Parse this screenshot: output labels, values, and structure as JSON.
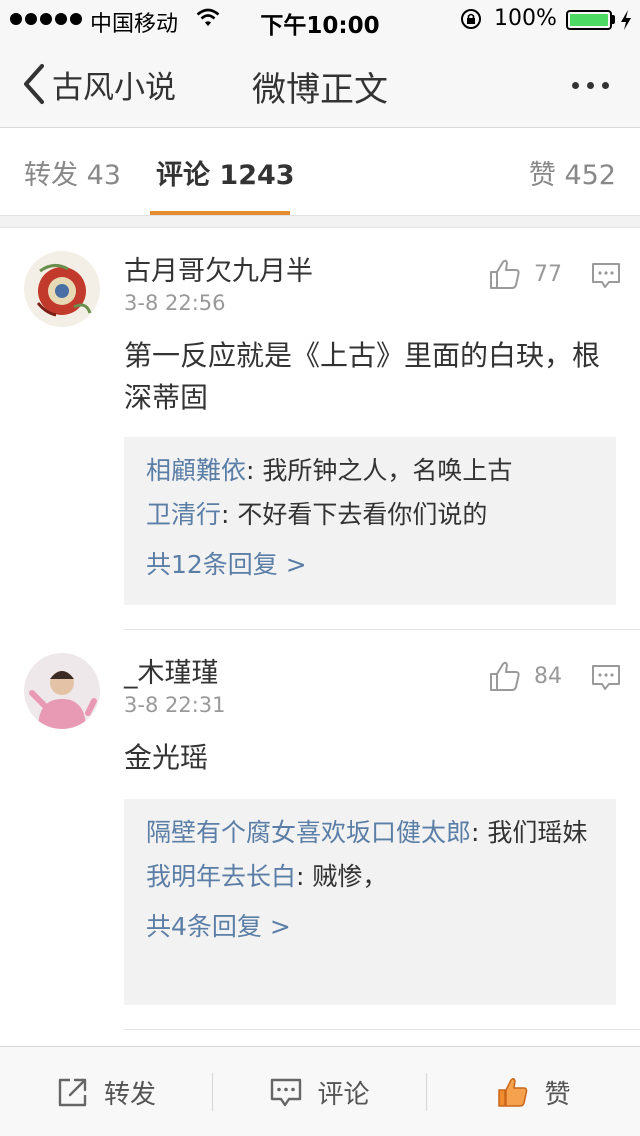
{
  "status_bar": {
    "carrier": "中国移动",
    "time": "下午10:00",
    "battery": "100%",
    "battery_color": "#4cd964"
  },
  "nav": {
    "back_label": "古风小说",
    "title": "微博正文",
    "back_icon": "chevron-left-icon",
    "more_icon": "more-dots-icon"
  },
  "tabs": {
    "repost": {
      "label": "转发",
      "count": "43"
    },
    "comment": {
      "label": "评论",
      "count": "1243"
    },
    "like": {
      "label": "赞",
      "count": "452"
    },
    "active_color": "#e68a2e"
  },
  "comments": [
    {
      "user": "古月哥欠九月半",
      "time": "3-8 22:56",
      "likes": "77",
      "text": "第一反应就是《上古》里面的白玦，根深蒂固",
      "replies": [
        {
          "user": "相顧難依",
          "text": ": 我所钟之人，名唤上古"
        },
        {
          "user": "卫清行",
          "text": ": 不好看下去看你们说的"
        }
      ],
      "more": "共12条回复 >"
    },
    {
      "user": "_木瑾瑾",
      "time": "3-8 22:31",
      "likes": "84",
      "text": "金光瑶",
      "replies": [
        {
          "user": "隔壁有个腐女喜欢坂口健太郎",
          "text": ": 我们瑶妹"
        },
        {
          "user": "我明年去长白",
          "text": ": 贼惨，"
        }
      ],
      "more": "共4条回复 >"
    }
  ],
  "toolbar": {
    "repost": "转发",
    "comment": "评论",
    "like": "赞",
    "like_color": "#f08c2e"
  },
  "colors": {
    "link": "#5b7ea6",
    "reply_bg": "#f2f2f2"
  }
}
